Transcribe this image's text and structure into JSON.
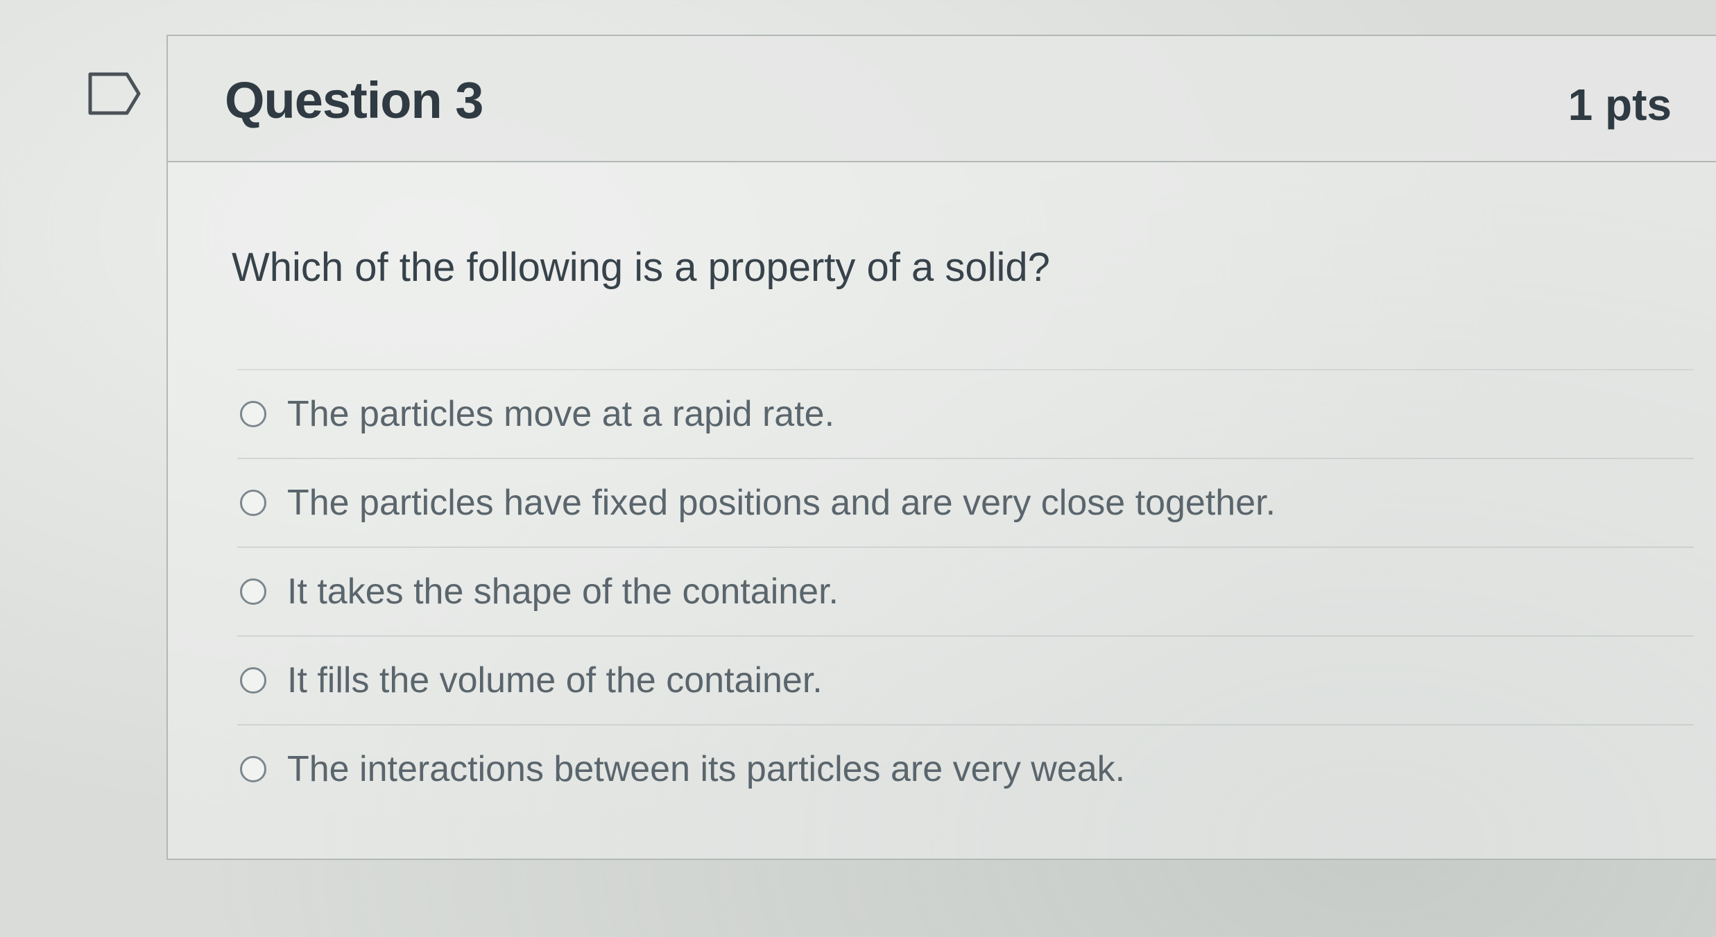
{
  "question": {
    "title": "Question 3",
    "points": "1 pts",
    "prompt": "Which of the following is a property of a solid?"
  },
  "answers": [
    {
      "label": "The particles move at a rapid rate.",
      "selected": false
    },
    {
      "label": "The particles have fixed positions and are very close together.",
      "selected": false
    },
    {
      "label": "It takes the shape of the container.",
      "selected": false
    },
    {
      "label": "It fills the volume of the container.",
      "selected": false
    },
    {
      "label": "The interactions between its particles are very weak.",
      "selected": false
    }
  ],
  "icons": {
    "flag": "flag-question-icon"
  }
}
